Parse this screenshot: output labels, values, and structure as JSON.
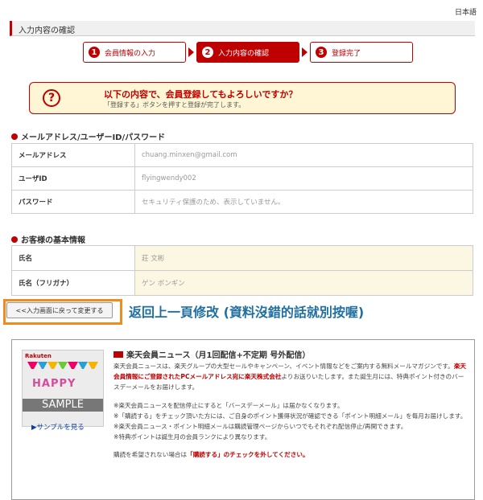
{
  "header": {
    "language": "日本語",
    "page_title": "入力内容の確認"
  },
  "steps": [
    {
      "num": "1",
      "label": "会員情報の入力",
      "active": false
    },
    {
      "num": "2",
      "label": "入力内容の確認",
      "active": true
    },
    {
      "num": "3",
      "label": "登録完了",
      "active": false
    }
  ],
  "confirm": {
    "question": "以下の内容で、会員登録してもよろしいですか？",
    "hint": "「登録する」ボタンを押すと登録が完了します。"
  },
  "section1": {
    "heading": "メールアドレス/ユーザーID/パスワード",
    "rows": [
      {
        "label": "メールアドレス",
        "value": "chuang.minxen@gmail.com"
      },
      {
        "label": "ユーザID",
        "value": "flyingwendy002"
      },
      {
        "label": "パスワード",
        "value": "セキュリティ保護のため、表示していません。"
      }
    ]
  },
  "section2": {
    "heading": "お客様の基本情報",
    "rows": [
      {
        "label": "氏名",
        "value": "莊 文彬"
      },
      {
        "label": "氏名（フリガナ）",
        "value": "ゲン ボンギン"
      }
    ]
  },
  "back_button": {
    "label": "<<入力画面に戻って変更する"
  },
  "annotation": "返回上一頁修改 (資料沒錯的話就別按喔)",
  "news": {
    "image_logo": "Rakuten",
    "image_text": "HAPPY",
    "image_watermark": "SAMPLE",
    "sample_link": "▶サンプルを見る",
    "title": "楽天会員ニュース（月1回配信+不定期 号外配信）",
    "p1_a": "楽天会員ニュースは、楽天グループの大型セールやキャンペーン、イベント情報などをご案内する無料メールマガジンです。",
    "p1_red": "楽天会員情報にご登録されたPCメールアドレス宛に楽天株式会社",
    "p1_b": "よりお送りいたします。また誕生月には、特典ポイント付きのバースデーメールをお届けします。",
    "n1": "※楽天会員ニュースを配信停止にすると「バースデーメール」は届かなくなります。",
    "n2": "※「購読する」をチェック頂いた方には、ご自身のポイント獲得状況が確認できる「ポイント明細メール」を毎月お届けします。",
    "n3": "※楽天会員ニュース・ポイント明細メールは購読管理ページからいつでもそれぞれ配信停止/再開できます。",
    "n4": "※特典ポイントは誕生月の会員ランクにより異なります。",
    "footer_a": "購読を希望されない場合は",
    "footer_red": "「購読する」のチェックを外してください。"
  }
}
